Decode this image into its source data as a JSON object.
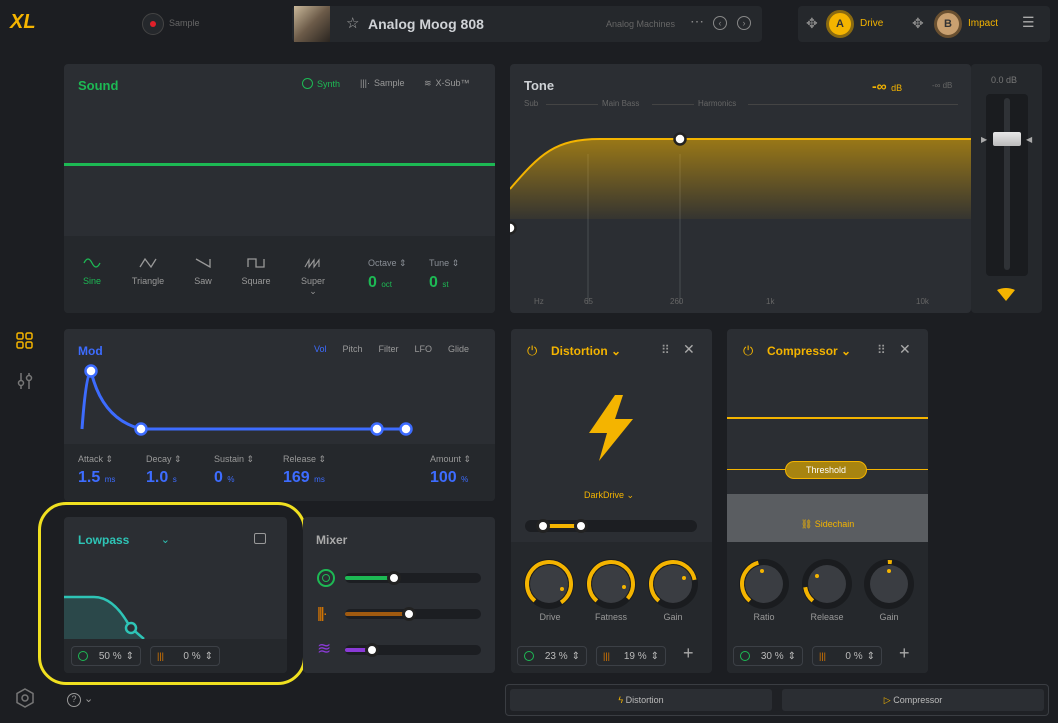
{
  "topbar": {
    "logo": "XL",
    "sample_label": "Sample",
    "preset_name": "Analog Moog 808",
    "preset_category": "Analog Machines",
    "slot_a_letter": "A",
    "slot_a_label": "Drive",
    "slot_b_letter": "B",
    "slot_b_label": "Impact"
  },
  "sound": {
    "title": "Sound",
    "modes": [
      "Synth",
      "Sample",
      "X-Sub™"
    ],
    "waves": [
      "Sine",
      "Triangle",
      "Saw",
      "Square",
      "Super"
    ],
    "octave_label": "Octave",
    "octave_value": "0",
    "octave_unit": "oct",
    "tune_label": "Tune",
    "tune_value": "0",
    "tune_unit": "st"
  },
  "tone": {
    "title": "Tone",
    "db_main": "-∞",
    "db_main_unit": "dB",
    "db_secondary": "-∞ dB",
    "bands": [
      "Sub",
      "Main Bass",
      "Harmonics"
    ],
    "freq_labels": [
      "Hz",
      "65",
      "260",
      "1k",
      "10k"
    ],
    "fader_value": "0.0 dB"
  },
  "mod": {
    "title": "Mod",
    "tabs": [
      "Vol",
      "Pitch",
      "Filter",
      "LFO",
      "Glide"
    ],
    "params": [
      {
        "label": "Attack",
        "value": "1.5",
        "unit": "ms"
      },
      {
        "label": "Decay",
        "value": "1.0",
        "unit": "s"
      },
      {
        "label": "Sustain",
        "value": "0",
        "unit": "%"
      },
      {
        "label": "Release",
        "value": "169",
        "unit": "ms"
      },
      {
        "label": "Amount",
        "value": "100",
        "unit": "%"
      }
    ]
  },
  "filter": {
    "title": "Lowpass",
    "synth_amount": "50 %",
    "sample_amount": "0 %"
  },
  "mixer": {
    "title": "Mixer"
  },
  "distortion": {
    "title": "Distortion",
    "type": "DarkDrive",
    "knobs": [
      "Drive",
      "Fatness",
      "Gain"
    ],
    "synth_amount": "23 %",
    "sample_amount": "19 %"
  },
  "compressor": {
    "title": "Compressor",
    "threshold_label": "Threshold",
    "sidechain_label": "Sidechain",
    "knobs": [
      "Ratio",
      "Release",
      "Gain"
    ],
    "synth_amount": "30 %",
    "sample_amount": "0 %"
  },
  "bottombar": {
    "distortion_tab": "Distortion",
    "compressor_tab": "Compressor"
  },
  "colors": {
    "accent": "#f4b400",
    "green": "#1db954",
    "blue": "#3d6cff",
    "teal": "#2ec4b6",
    "purple": "#8a3ad6",
    "orange": "#e07a00"
  }
}
